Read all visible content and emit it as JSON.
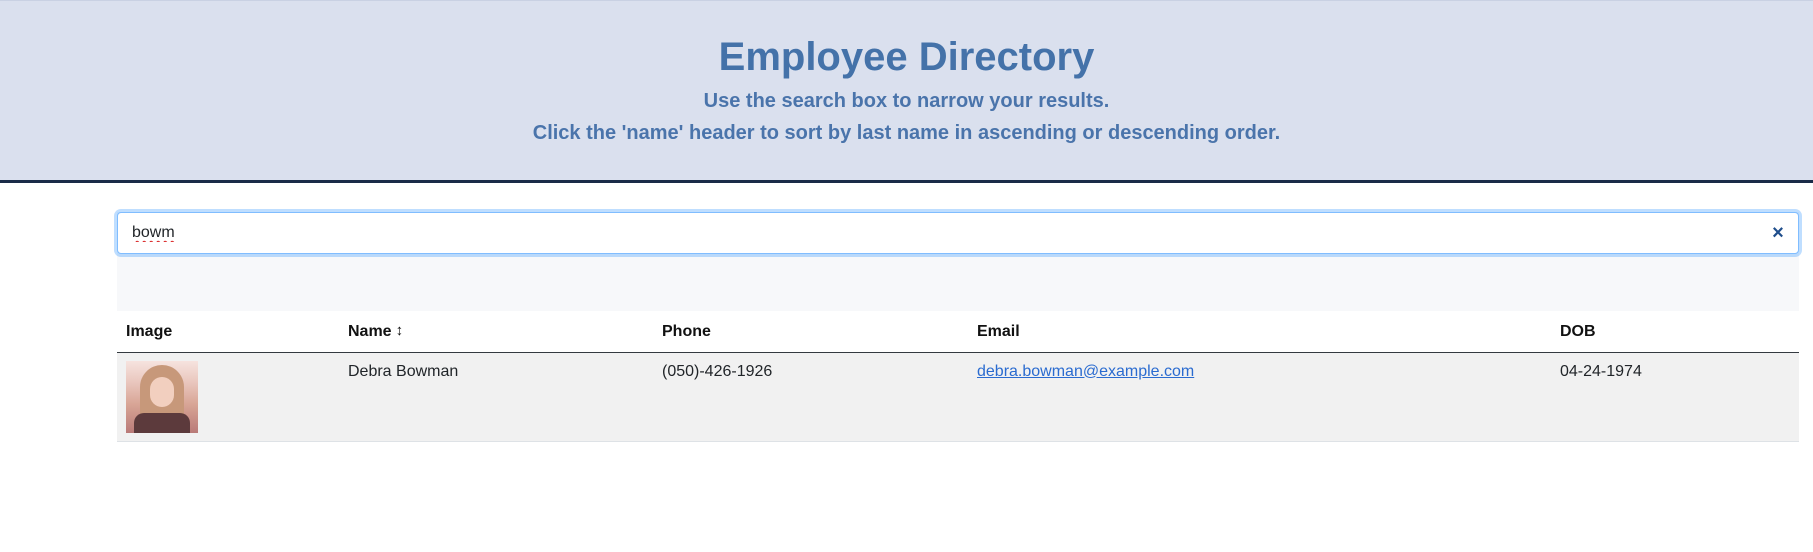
{
  "header": {
    "title": "Employee Directory",
    "subtitle1": "Use the search box to narrow your results.",
    "subtitle2": "Click the 'name' header to sort by last name in ascending or descending order."
  },
  "search": {
    "value": "bowm",
    "clear_glyph": "×"
  },
  "table": {
    "headers": {
      "image": "Image",
      "name": "Name",
      "sort_glyph": "↕",
      "phone": "Phone",
      "email": "Email",
      "dob": "DOB"
    },
    "rows": [
      {
        "image_icon": "employee-photo",
        "name": "Debra Bowman",
        "phone": "(050)-426-1926",
        "email": "debra.bowman@example.com",
        "dob": "04-24-1974"
      }
    ]
  },
  "colors": {
    "header_bg": "#dae0ee",
    "header_text": "#4472a9",
    "header_border": "#1a2b48",
    "link": "#2a6bd0",
    "row_bg": "#f1f1f1"
  }
}
